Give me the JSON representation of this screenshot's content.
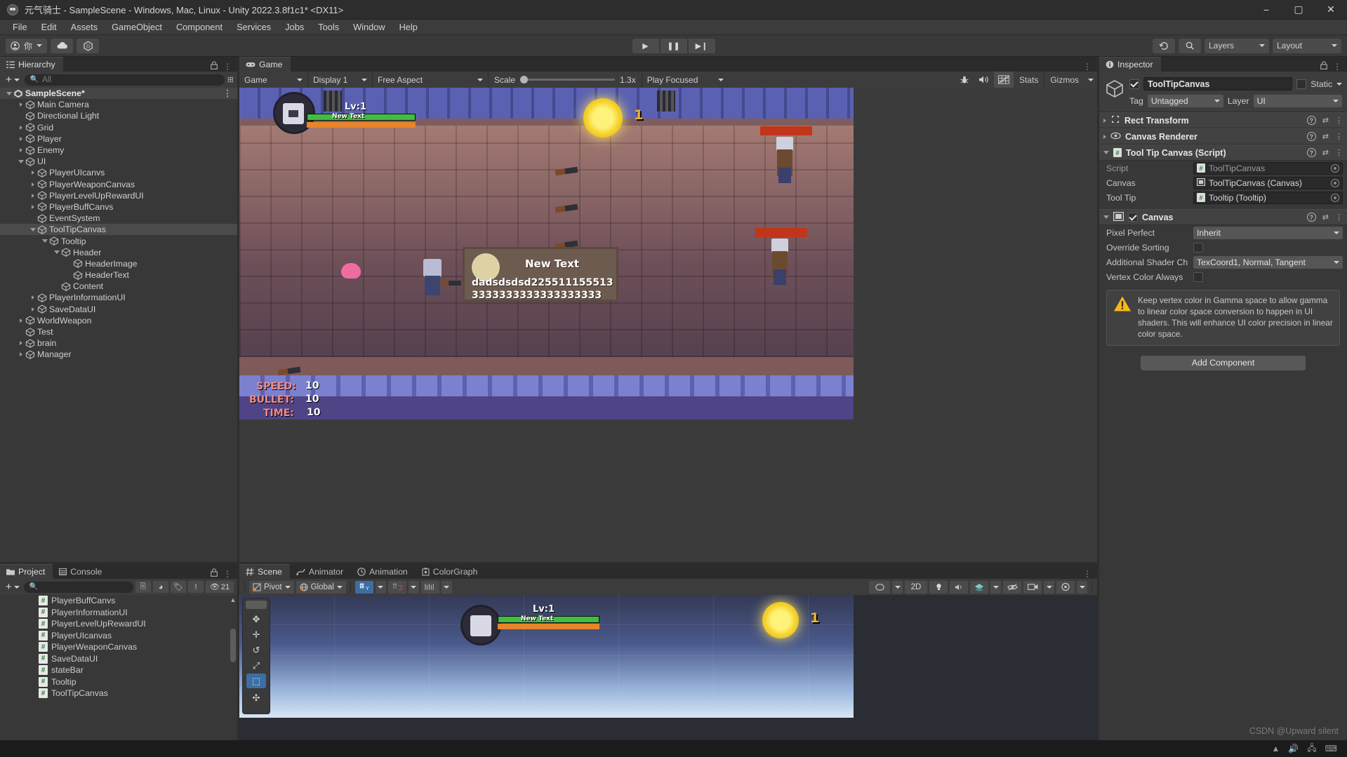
{
  "window": {
    "title": "元气骑士 - SampleScene - Windows, Mac, Linux - Unity 2022.3.8f1c1* <DX11>",
    "minimize": "−",
    "maximize": "▢",
    "close": "✕"
  },
  "menu": {
    "items": [
      "File",
      "Edit",
      "Assets",
      "GameObject",
      "Component",
      "Services",
      "Jobs",
      "Tools",
      "Window",
      "Help"
    ]
  },
  "toolbar": {
    "account_label": "你",
    "cloud_icon": "cloud-icon",
    "collab_icon": "unity-collab-icon",
    "play": "▶",
    "pause": "❚❚",
    "step": "▶❙",
    "history_icon": "undo-history-icon",
    "search_icon": "search-icon",
    "layers_label": "Layers",
    "layout_label": "Layout"
  },
  "hierarchy": {
    "tab": "Hierarchy",
    "search_placeholder": "All",
    "rows": [
      {
        "label": "SampleScene*",
        "depth": 0,
        "twisty": "open",
        "kind": "scene",
        "selected": false
      },
      {
        "label": "Main Camera",
        "depth": 1,
        "twisty": "closed",
        "kind": "go",
        "selected": false
      },
      {
        "label": "Directional Light",
        "depth": 1,
        "twisty": "none",
        "kind": "go",
        "selected": false
      },
      {
        "label": "Grid",
        "depth": 1,
        "twisty": "closed",
        "kind": "go",
        "selected": false
      },
      {
        "label": "Player",
        "depth": 1,
        "twisty": "closed",
        "kind": "go",
        "selected": false
      },
      {
        "label": "Enemy",
        "depth": 1,
        "twisty": "closed",
        "kind": "go",
        "selected": false
      },
      {
        "label": "UI",
        "depth": 1,
        "twisty": "open",
        "kind": "go",
        "selected": false
      },
      {
        "label": "PlayerUIcanvs",
        "depth": 2,
        "twisty": "closed",
        "kind": "go",
        "selected": false
      },
      {
        "label": "PlayerWeaponCanvas",
        "depth": 2,
        "twisty": "closed",
        "kind": "go",
        "selected": false
      },
      {
        "label": "PlayerLevelUpRewardUI",
        "depth": 2,
        "twisty": "closed",
        "kind": "go",
        "selected": false
      },
      {
        "label": "PlayerBuffCanvs",
        "depth": 2,
        "twisty": "closed",
        "kind": "go",
        "selected": false
      },
      {
        "label": "EventSystem",
        "depth": 2,
        "twisty": "none",
        "kind": "go",
        "selected": false
      },
      {
        "label": "ToolTipCanvas",
        "depth": 2,
        "twisty": "open",
        "kind": "go",
        "selected": true
      },
      {
        "label": "Tooltip",
        "depth": 3,
        "twisty": "open",
        "kind": "go",
        "selected": false
      },
      {
        "label": "Header",
        "depth": 4,
        "twisty": "open",
        "kind": "go",
        "selected": false
      },
      {
        "label": "HeaderImage",
        "depth": 5,
        "twisty": "none",
        "kind": "go",
        "selected": false
      },
      {
        "label": "HeaderText",
        "depth": 5,
        "twisty": "none",
        "kind": "go",
        "selected": false
      },
      {
        "label": "Content",
        "depth": 4,
        "twisty": "none",
        "kind": "go",
        "selected": false
      },
      {
        "label": "PlayerInformationUI",
        "depth": 2,
        "twisty": "closed",
        "kind": "go",
        "selected": false
      },
      {
        "label": "SaveDataUI",
        "depth": 2,
        "twisty": "closed",
        "kind": "go",
        "selected": false
      },
      {
        "label": "WorldWeapon",
        "depth": 1,
        "twisty": "closed",
        "kind": "go",
        "selected": false
      },
      {
        "label": "Test",
        "depth": 1,
        "twisty": "none",
        "kind": "go",
        "selected": false
      },
      {
        "label": "brain",
        "depth": 1,
        "twisty": "closed",
        "kind": "go",
        "selected": false
      },
      {
        "label": "Manager",
        "depth": 1,
        "twisty": "closed",
        "kind": "go",
        "selected": false
      }
    ]
  },
  "game_view": {
    "tab": "Game",
    "target_display_label": "Game",
    "display": "Display 1",
    "aspect": "Free Aspect",
    "scale_label": "Scale",
    "scale_value": "1.3x",
    "play_mode": "Play Focused",
    "stats": "Stats",
    "gizmos": "Gizmos",
    "mute_icon": "mute-audio-icon",
    "debug_icon": "debug-bug-icon",
    "grid_icon": "frame-debugger-icon",
    "hud": {
      "level": "Lv:1",
      "bar_text": "New Text",
      "coin_count": "1",
      "speed_label": "SPEED:",
      "speed_value": "10",
      "bullet_label": "BULLET:",
      "bullet_value": "10",
      "time_label": "TIME:",
      "time_value": "10"
    },
    "tooltip": {
      "header": "New Text",
      "content": "dadsdsdsd2255111555133333333333333333333"
    }
  },
  "scene_view": {
    "tabs": [
      "Scene",
      "Animator",
      "Animation",
      "ColorGraph"
    ],
    "active_tab": "Scene",
    "pivot": "Pivot",
    "space": "Global",
    "mode_2d": "2D",
    "hud": {
      "level": "Lv:1",
      "bar_text": "New Text",
      "coin_count": "1"
    }
  },
  "project": {
    "tabs": [
      "Project",
      "Console"
    ],
    "active_tab": "Project",
    "search_placeholder": "",
    "warning_count": "21",
    "items": [
      "PlayerBuffCanvs",
      "PlayerInformationUI",
      "PlayerLevelUpRewardUI",
      "PlayerUIcanvas",
      "PlayerWeaponCanvas",
      "SaveDataUI",
      "stateBar",
      "Tooltip",
      "ToolTipCanvas"
    ]
  },
  "inspector": {
    "tab": "Inspector",
    "object_name": "ToolTipCanvas",
    "enabled": true,
    "static_label": "Static",
    "tag_label": "Tag",
    "tag_value": "Untagged",
    "layer_label": "Layer",
    "layer_value": "UI",
    "components": [
      {
        "name": "Rect Transform",
        "expanded": false,
        "icon": "rect-transform-icon"
      },
      {
        "name": "Canvas Renderer",
        "expanded": false,
        "icon": "canvas-renderer-icon"
      },
      {
        "name": "Tool Tip Canvas (Script)",
        "expanded": true,
        "icon": "script-icon"
      }
    ],
    "script_props": [
      {
        "label": "Script",
        "value": "ToolTipCanvas",
        "dim": true,
        "icon": "script-icon"
      },
      {
        "label": "Canvas",
        "value": "ToolTipCanvas (Canvas)",
        "dim": false,
        "icon": "canvas-icon"
      },
      {
        "label": "Tool Tip",
        "value": "Tooltip (Tooltip)",
        "dim": false,
        "icon": "script-icon"
      }
    ],
    "canvas_component": {
      "name": "Canvas",
      "enabled": true,
      "props": [
        {
          "label": "Pixel Perfect",
          "type": "dropdown",
          "value": "Inherit"
        },
        {
          "label": "Override Sorting",
          "type": "checkbox",
          "value": false
        },
        {
          "label": "Additional Shader Ch",
          "type": "dropdown",
          "value": "TexCoord1, Normal, Tangent"
        },
        {
          "label": "Vertex Color Always",
          "type": "checkbox",
          "value": false
        }
      ],
      "warning": "Keep vertex color in Gamma space to allow gamma to linear color space conversion to happen in UI shaders. This will enhance UI color precision in linear color space."
    },
    "add_component": "Add Component"
  },
  "watermark": "CSDN @Upward silent",
  "colors": {
    "accent_blue": "#3b6ea5",
    "selection": "#4b4b4b",
    "panel_bg": "#383838",
    "warning_yellow": "#f5b91e"
  }
}
